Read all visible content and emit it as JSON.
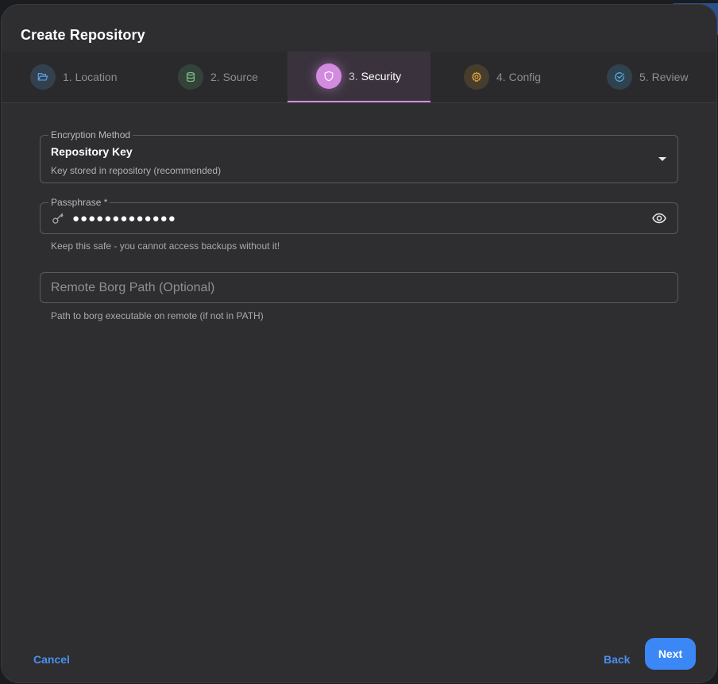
{
  "dialog": {
    "title": "Create Repository"
  },
  "steps": [
    {
      "num": "1.",
      "label": "Location",
      "icon": "folder-open-icon",
      "color": "#5aa0e8",
      "bg": "#33414f"
    },
    {
      "num": "2.",
      "label": "Source",
      "icon": "database-icon",
      "color": "#7fbf84",
      "bg": "#34433a"
    },
    {
      "num": "3.",
      "label": "Security",
      "icon": "shield-icon",
      "color": "#ffffff",
      "bg": "#d38be0",
      "active": true
    },
    {
      "num": "4.",
      "label": "Config",
      "icon": "gear-icon",
      "color": "#e0a43a",
      "bg": "#473d2c"
    },
    {
      "num": "5.",
      "label": "Review",
      "icon": "check-circle-icon",
      "color": "#5ab2e0",
      "bg": "#2f4250"
    }
  ],
  "encryption": {
    "label": "Encryption Method",
    "value": "Repository Key",
    "description": "Key stored in repository (recommended)"
  },
  "passphrase": {
    "label": "Passphrase *",
    "masked_value": "●●●●●●●●●●●●●",
    "helper": "Keep this safe - you cannot access backups without it!"
  },
  "remote_path": {
    "placeholder": "Remote Borg Path (Optional)",
    "helper": "Path to borg executable on remote (if not in PATH)"
  },
  "footer": {
    "cancel": "Cancel",
    "back": "Back",
    "next": "Next"
  },
  "colors": {
    "accent": "#3b87f5",
    "active_step": "#d38be0"
  }
}
